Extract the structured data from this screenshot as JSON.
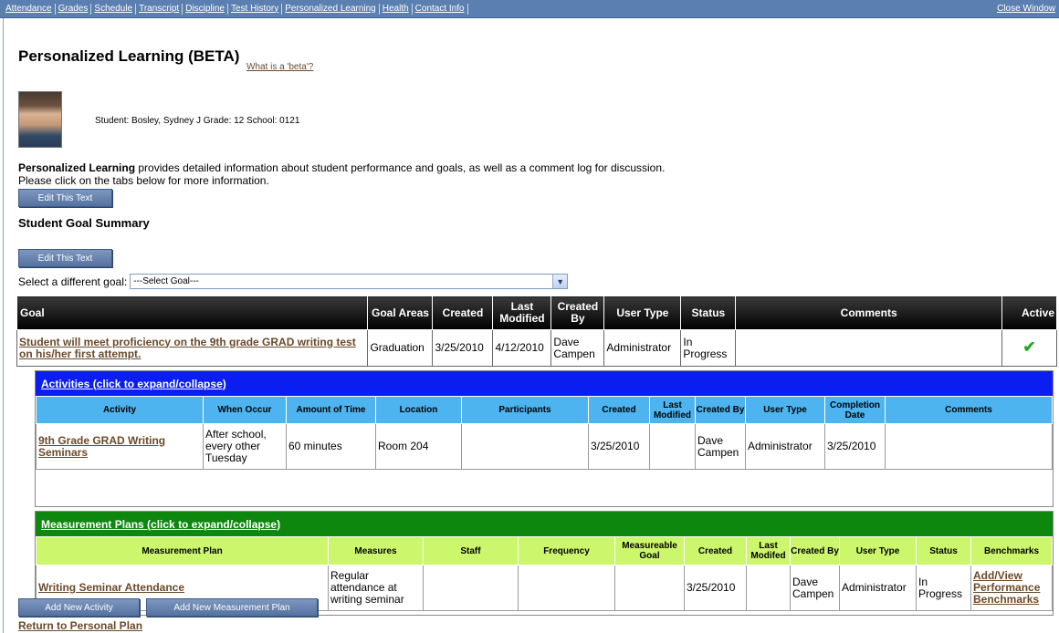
{
  "nav": {
    "items": [
      "Attendance",
      "Grades",
      "Schedule",
      "Transcript",
      "Discipline",
      "Test History",
      "Personalized Learning",
      "Health",
      "Contact Info"
    ],
    "close": "Close Window"
  },
  "page": {
    "title": "Personalized Learning (BETA)",
    "beta_link": "What is a 'beta'?",
    "student_info": "Student: Bosley, Sydney J Grade: 12 School: 0121",
    "intro_bold": "Personalized Learning",
    "intro_rest": " provides detailed information about student performance and goals, as well as a comment log for discussion.",
    "intro_line2": "Please click on the tabs below for more information.",
    "edit_text_1": "Edit This Text",
    "summary_title": "Student Goal Summary",
    "edit_text_2": "Edit This Text",
    "select_label": "Select a different goal:",
    "select_value": "---Select Goal---"
  },
  "goal_table": {
    "headers": [
      "Goal",
      "Goal Areas",
      "Created",
      "Last Modified",
      "Created By",
      "User Type",
      "Status",
      "Comments",
      "Active"
    ],
    "row": {
      "goal": "Student will meet proficiency on the 9th grade GRAD writing test on his/her first attempt.",
      "areas": "Graduation",
      "created": "3/25/2010",
      "modified": "4/12/2010",
      "created_by": "Dave Campen",
      "user_type": "Administrator",
      "status": "In Progress",
      "comments": "",
      "active": "✔"
    }
  },
  "activities": {
    "heading": "Activities (click to expand/collapse)",
    "headers": [
      "Activity",
      "When Occur",
      "Amount of Time",
      "Location",
      "Participants",
      "Created",
      "Last Modified",
      "Created By",
      "User Type",
      "Completion Date",
      "Comments"
    ],
    "row": {
      "activity": "9th Grade GRAD Writing Seminars",
      "when": "After school, every other Tuesday",
      "time": "60 minutes",
      "location": "Room 204",
      "participants": "",
      "created": "3/25/2010",
      "modified": "",
      "created_by": "Dave Campen",
      "user_type": "Administrator",
      "completion": "3/25/2010",
      "comments": ""
    }
  },
  "measurement": {
    "heading": "Measurement Plans (click to expand/collapse)",
    "headers": [
      "Measurement Plan",
      "Measures",
      "Staff",
      "Frequency",
      "Measureable Goal",
      "Created",
      "Last Modifed",
      "Created By",
      "User Type",
      "Status",
      "Benchmarks"
    ],
    "row": {
      "plan": "Writing Seminar Attendance",
      "measures": "Regular attendance at writing seminar",
      "staff": "",
      "frequency": "",
      "goal": "",
      "created": "3/25/2010",
      "modified": "",
      "created_by": "Dave Campen",
      "user_type": "Administrator",
      "status": "In Progress",
      "benchmarks": "Add/View Performance Benchmarks"
    }
  },
  "footer": {
    "add_activity": "Add New Activity",
    "add_plan": "Add New Measurement Plan",
    "return": "Return to Personal Plan"
  }
}
